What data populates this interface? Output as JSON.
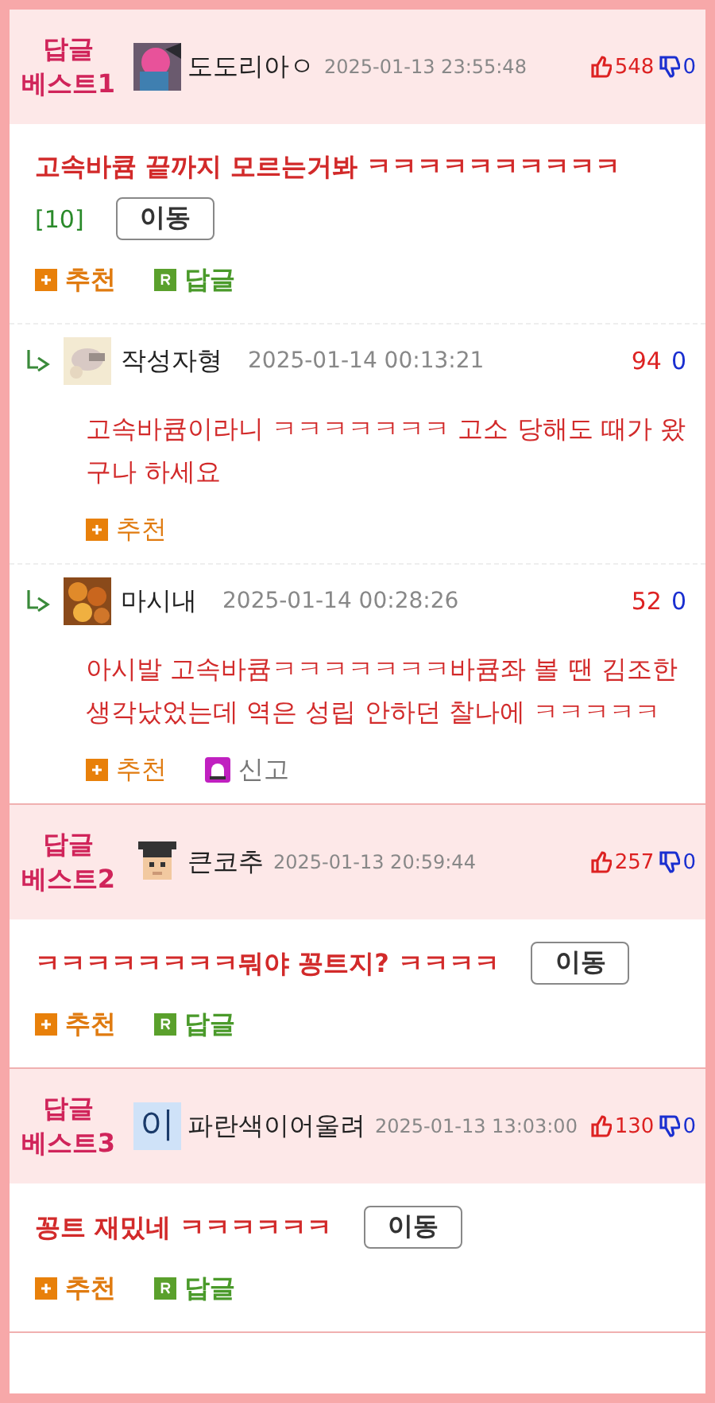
{
  "comments": [
    {
      "badge": [
        "답글",
        "베스트1"
      ],
      "avatar": {
        "kind": "picture"
      },
      "author": "도도리아ㅇ",
      "time": "2025-01-13 23:55:48",
      "up": "548",
      "down": "0",
      "body": "고속바큠 끝까지 모르는거봐 ㅋㅋㅋㅋㅋㅋㅋㅋㅋㅋ",
      "reply_count": "[10]",
      "move": "이동",
      "actions": [
        {
          "kind": "recommend",
          "label": "추천"
        },
        {
          "kind": "reply",
          "label": "답글"
        }
      ],
      "replies": [
        {
          "avatar": {
            "kind": "picture"
          },
          "author": "작성자형",
          "time": "2025-01-14 00:13:21",
          "up": "94",
          "down": "0",
          "body": "고속바큠이라니 ㅋㅋㅋㅋㅋㅋㅋ 고소 당해도 때가 왔구나 하세요",
          "actions": [
            {
              "kind": "recommend",
              "label": "추천"
            }
          ]
        },
        {
          "avatar": {
            "kind": "picture"
          },
          "author": "마시내",
          "time": "2025-01-14 00:28:26",
          "up": "52",
          "down": "0",
          "body": "아시발 고속바큠ㅋㅋㅋㅋㅋㅋㅋ바큠좌 볼 땐 김조한 생각났었는데 역은 성립 안하던 찰나에 ㅋㅋㅋㅋㅋ",
          "actions": [
            {
              "kind": "recommend",
              "label": "추천"
            },
            {
              "kind": "report",
              "label": "신고"
            }
          ]
        }
      ]
    },
    {
      "badge": [
        "답글",
        "베스트2"
      ],
      "avatar": {
        "kind": "pixel"
      },
      "author": "큰코추",
      "time": "2025-01-13 20:59:44",
      "up": "257",
      "down": "0",
      "body": "ㅋㅋㅋㅋㅋㅋㅋㅋ뭐야 꽁트지? ㅋㅋㅋㅋ",
      "move": "이동",
      "actions": [
        {
          "kind": "recommend",
          "label": "추천"
        },
        {
          "kind": "reply",
          "label": "답글"
        }
      ]
    },
    {
      "badge": [
        "답글",
        "베스트3"
      ],
      "avatar": {
        "kind": "letter",
        "text": "이"
      },
      "author": "파란색이어울려",
      "time": "2025-01-13 13:03:00",
      "up": "130",
      "down": "0",
      "body": "꽁트 재밌네 ㅋㅋㅋㅋㅋㅋ",
      "move": "이동",
      "actions": [
        {
          "kind": "recommend",
          "label": "추천"
        },
        {
          "kind": "reply",
          "label": "답글"
        }
      ]
    }
  ]
}
